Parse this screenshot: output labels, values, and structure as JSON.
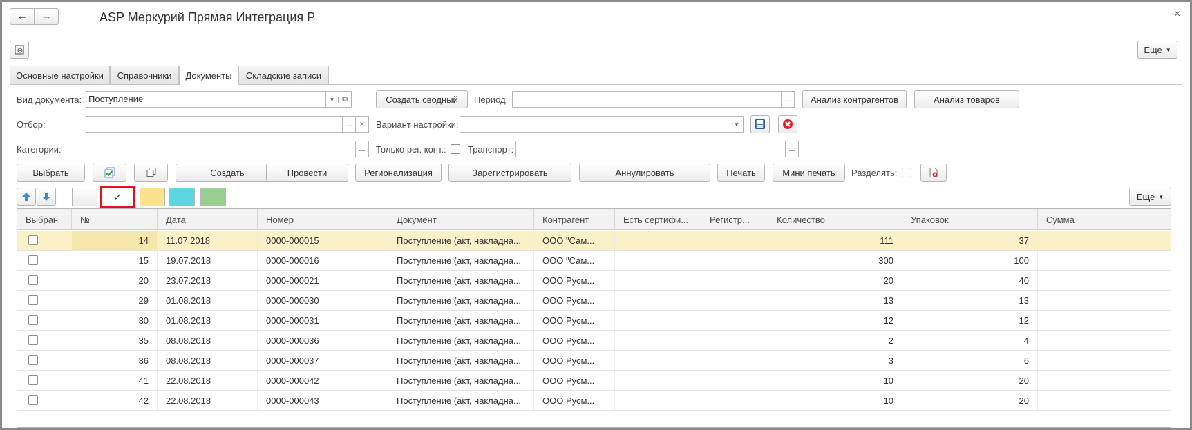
{
  "window": {
    "title": "ASP Меркурий Прямая Интеграция Р",
    "back": "←",
    "forward": "→",
    "close": "×"
  },
  "toolbar": {
    "more_label": "Еще"
  },
  "tabs": [
    {
      "label": "Основные настройки"
    },
    {
      "label": "Справочники"
    },
    {
      "label": "Документы"
    },
    {
      "label": "Складские записи"
    }
  ],
  "filters": {
    "doc_type_label": "Вид документа:",
    "doc_type_value": "Поступление",
    "create_summary": "Создать сводный",
    "period_label": "Период:",
    "period_value": "",
    "analysis_contractors": "Анализ контрагентов",
    "analysis_goods": "Анализ товаров",
    "selection_label": "Отбор:",
    "selection_value": "",
    "variant_label": "Вариант настройки:",
    "variant_value": "",
    "categories_label": "Категории:",
    "categories_value": "",
    "only_reg_label": "Только рег. конт.:",
    "transport_label": "Транспорт:",
    "transport_value": ""
  },
  "actions": {
    "select": "Выбрать",
    "create": "Создать",
    "post": "Провести",
    "regionalize": "Регионализация",
    "register": "Зарегистрировать",
    "cancel": "Аннулировать",
    "print": "Печать",
    "mini_print": "Мини печать",
    "split_label": "Разделять:"
  },
  "grid_toolbar": {
    "check_mark": "✓",
    "more_label": "Еще"
  },
  "colors": {
    "swatch_yellow": "#fde38f",
    "swatch_cyan": "#5ed6df",
    "swatch_green": "#99cf8e",
    "highlight": "#e8101f"
  },
  "table": {
    "headers": [
      "Выбран",
      "№",
      "Дата",
      "Номер",
      "Документ",
      "Контрагент",
      "Есть сертифи...",
      "Регистр...",
      "Количество",
      "Упаковок",
      "Сумма"
    ],
    "rows": [
      {
        "n": "14",
        "date": "11.07.2018",
        "number": "0000-000015",
        "doc": "Поступление (акт, накладна...",
        "contractor": "ООО \"Сам...",
        "qty": "111",
        "packs": "37"
      },
      {
        "n": "15",
        "date": "19.07.2018",
        "number": "0000-000016",
        "doc": "Поступление (акт, накладна...",
        "contractor": "ООО \"Сам...",
        "qty": "300",
        "packs": "100"
      },
      {
        "n": "20",
        "date": "23.07.2018",
        "number": "0000-000021",
        "doc": "Поступление (акт, накладна...",
        "contractor": "ООО Русм...",
        "qty": "20",
        "packs": "40"
      },
      {
        "n": "29",
        "date": "01.08.2018",
        "number": "0000-000030",
        "doc": "Поступление (акт, накладна...",
        "contractor": "ООО Русм...",
        "qty": "13",
        "packs": "13"
      },
      {
        "n": "30",
        "date": "01.08.2018",
        "number": "0000-000031",
        "doc": "Поступление (акт, накладна...",
        "contractor": "ООО Русм...",
        "qty": "12",
        "packs": "12"
      },
      {
        "n": "35",
        "date": "08.08.2018",
        "number": "0000-000036",
        "doc": "Поступление (акт, накладна...",
        "contractor": "ООО Русм...",
        "qty": "2",
        "packs": "4"
      },
      {
        "n": "36",
        "date": "08.08.2018",
        "number": "0000-000037",
        "doc": "Поступление (акт, накладна...",
        "contractor": "ООО Русм...",
        "qty": "3",
        "packs": "6"
      },
      {
        "n": "41",
        "date": "22.08.2018",
        "number": "0000-000042",
        "doc": "Поступление (акт, накладна...",
        "contractor": "ООО Русм...",
        "qty": "10",
        "packs": "20"
      },
      {
        "n": "42",
        "date": "22.08.2018",
        "number": "0000-000043",
        "doc": "Поступление (акт, накладна...",
        "contractor": "ООО Русм...",
        "qty": "10",
        "packs": "20"
      }
    ]
  }
}
